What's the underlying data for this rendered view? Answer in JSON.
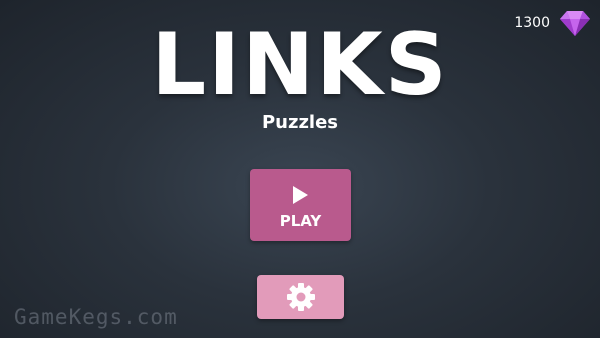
{
  "game": {
    "title": "LINKS",
    "subtitle": "Puzzles"
  },
  "currency": {
    "gem_count": "1300",
    "icon": "gem-icon",
    "gem_color": "#c258e8"
  },
  "menu": {
    "play_label": "PLAY",
    "play_icon": "play-icon",
    "settings_icon": "gear-icon"
  },
  "colors": {
    "play_button": "#b95a8d",
    "settings_button": "#e29bba",
    "background": "#2a323c"
  },
  "watermark": "GameKegs.com"
}
